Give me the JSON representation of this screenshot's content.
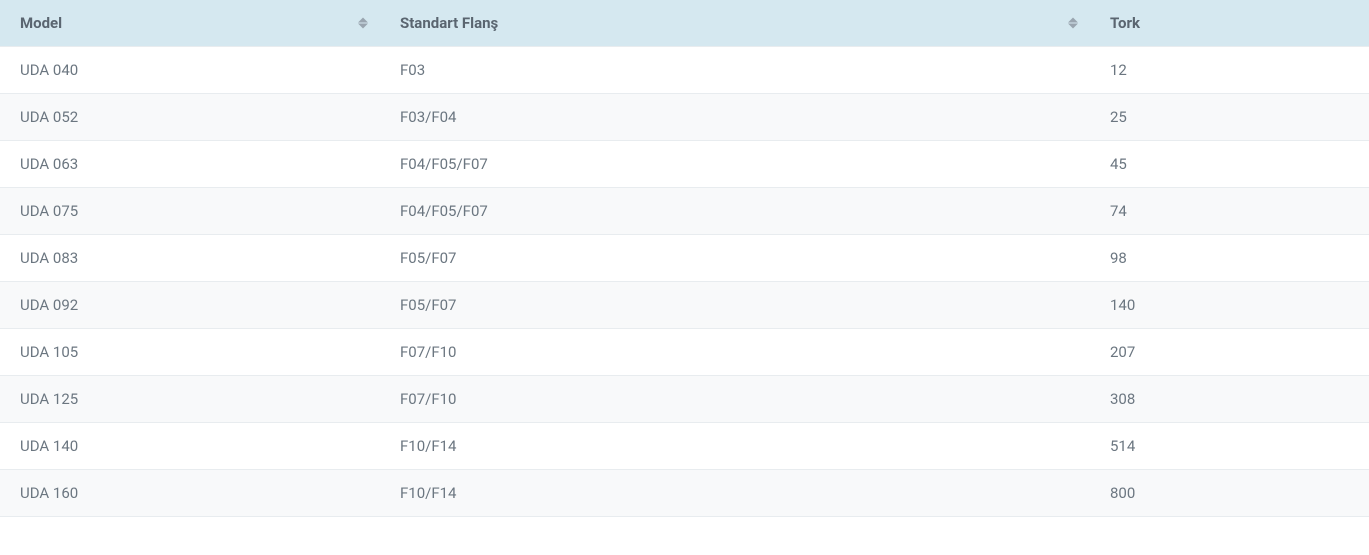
{
  "table": {
    "headers": {
      "model": "Model",
      "flange": "Standart Flanş",
      "tork": "Tork"
    },
    "rows": [
      {
        "model": "UDA 040",
        "flange": "F03",
        "tork": "12"
      },
      {
        "model": "UDA 052",
        "flange": "F03/F04",
        "tork": "25"
      },
      {
        "model": "UDA 063",
        "flange": "F04/F05/F07",
        "tork": "45"
      },
      {
        "model": "UDA 075",
        "flange": "F04/F05/F07",
        "tork": "74"
      },
      {
        "model": "UDA 083",
        "flange": "F05/F07",
        "tork": "98"
      },
      {
        "model": "UDA 092",
        "flange": "F05/F07",
        "tork": "140"
      },
      {
        "model": "UDA 105",
        "flange": "F07/F10",
        "tork": "207"
      },
      {
        "model": "UDA 125",
        "flange": "F07/F10",
        "tork": "308"
      },
      {
        "model": "UDA 140",
        "flange": "F10/F14",
        "tork": "514"
      },
      {
        "model": "UDA 160",
        "flange": "F10/F14",
        "tork": "800"
      }
    ]
  }
}
